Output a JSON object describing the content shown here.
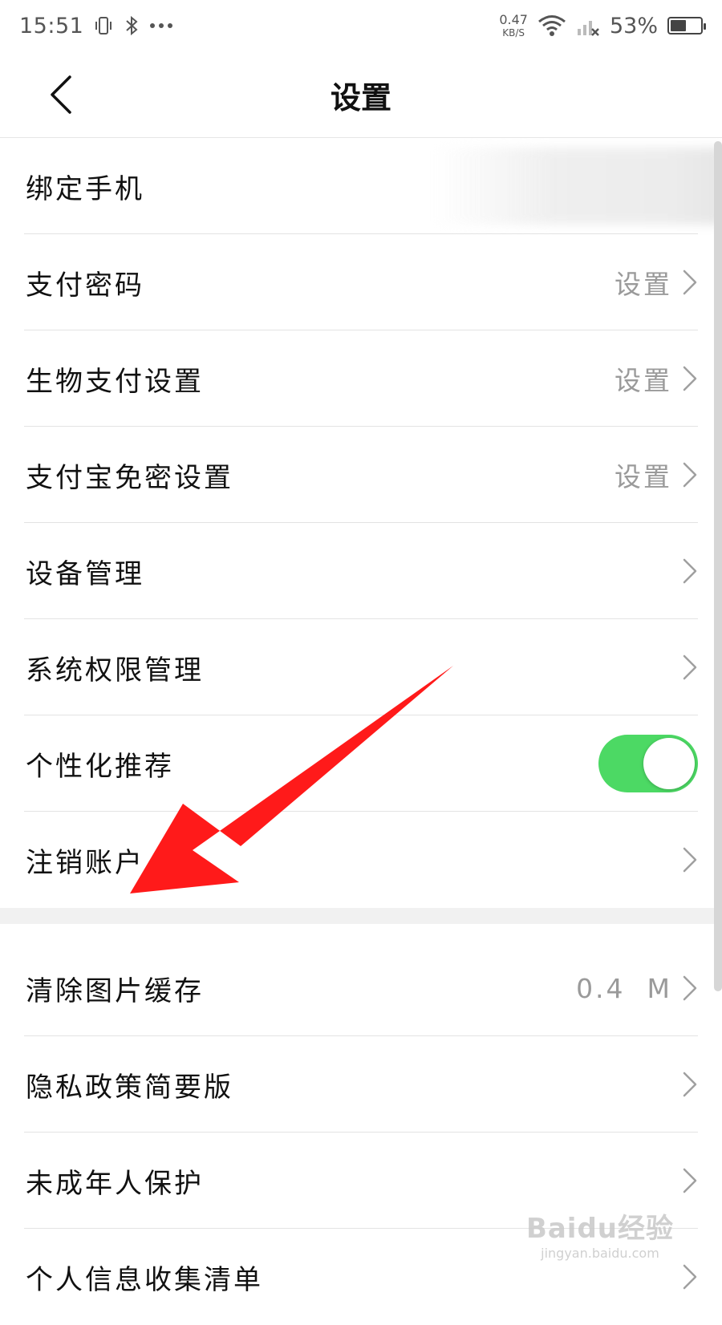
{
  "status_bar": {
    "time": "15:51",
    "net_speed_value": "0.47",
    "net_speed_unit": "KB/S",
    "battery_percent": "53%",
    "battery_level": 0.53
  },
  "header": {
    "title": "设置"
  },
  "settings": {
    "group1": [
      {
        "label": "绑定手机",
        "value": ""
      },
      {
        "label": "支付密码",
        "value": "设置"
      },
      {
        "label": "生物支付设置",
        "value": "设置"
      },
      {
        "label": "支付宝免密设置",
        "value": "设置"
      },
      {
        "label": "设备管理",
        "value": ""
      },
      {
        "label": "系统权限管理",
        "value": ""
      },
      {
        "label": "个性化推荐",
        "toggle_on": true
      },
      {
        "label": "注销账户",
        "value": ""
      }
    ],
    "group2": [
      {
        "label": "清除图片缓存",
        "value": "0.4  M"
      },
      {
        "label": "隐私政策简要版",
        "value": ""
      },
      {
        "label": "未成年人保护",
        "value": ""
      },
      {
        "label": "个人信息收集清单",
        "value": ""
      }
    ]
  },
  "colors": {
    "toggle_on": "#4cd964",
    "annotation_arrow": "#ff1a1a"
  },
  "icons": {
    "back": "chevron-left-icon",
    "row_arrow": "chevron-right-icon"
  },
  "watermark": {
    "brand": "Baidu经验",
    "url": "jingyan.baidu.com"
  }
}
